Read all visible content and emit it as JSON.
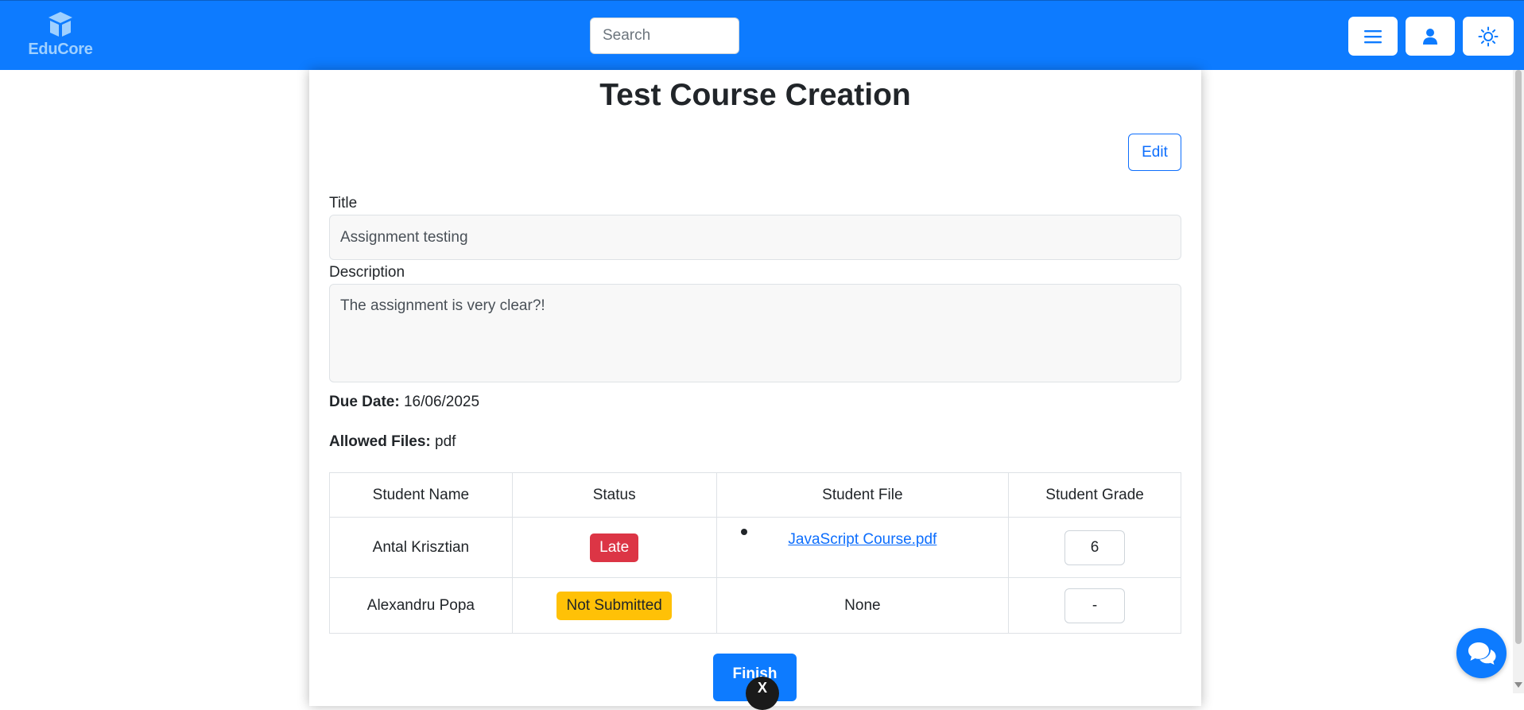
{
  "navbar": {
    "brand": "EduCore",
    "brand_icon": "graduation-cube-icon",
    "search_placeholder": "Search",
    "buttons": [
      {
        "icon": "hamburger-menu-icon"
      },
      {
        "icon": "user-icon"
      },
      {
        "icon": "sun-icon"
      }
    ],
    "colors": {
      "bar": "#0d7bff",
      "brand": "#9fd0ff"
    }
  },
  "assignment": {
    "page_title": "Test Course Creation",
    "edit_label": "Edit",
    "title_label": "Title",
    "title_value": "Assignment testing",
    "description_label": "Description",
    "description_value": "The assignment is very clear?!",
    "due_date_label": "Due Date:",
    "due_date_value": "16/06/2025",
    "allowed_files_label": "Allowed Files:",
    "allowed_files_value": "pdf"
  },
  "table": {
    "headers": [
      "Student Name",
      "Status",
      "Student File",
      "Student Grade"
    ],
    "rows": [
      {
        "name": "Antal Krisztian",
        "status": "Late",
        "status_color": "#dc3545",
        "file": "JavaScript Course.pdf",
        "grade": "6"
      },
      {
        "name": "Alexandru Popa",
        "status": "Not Submitted",
        "status_color": "#ffc107",
        "file": "None",
        "grade": "-"
      }
    ]
  },
  "actions": {
    "finish_label": "Finish",
    "close_glyph": "X",
    "chat_icon": "chat-bubbles-icon"
  }
}
